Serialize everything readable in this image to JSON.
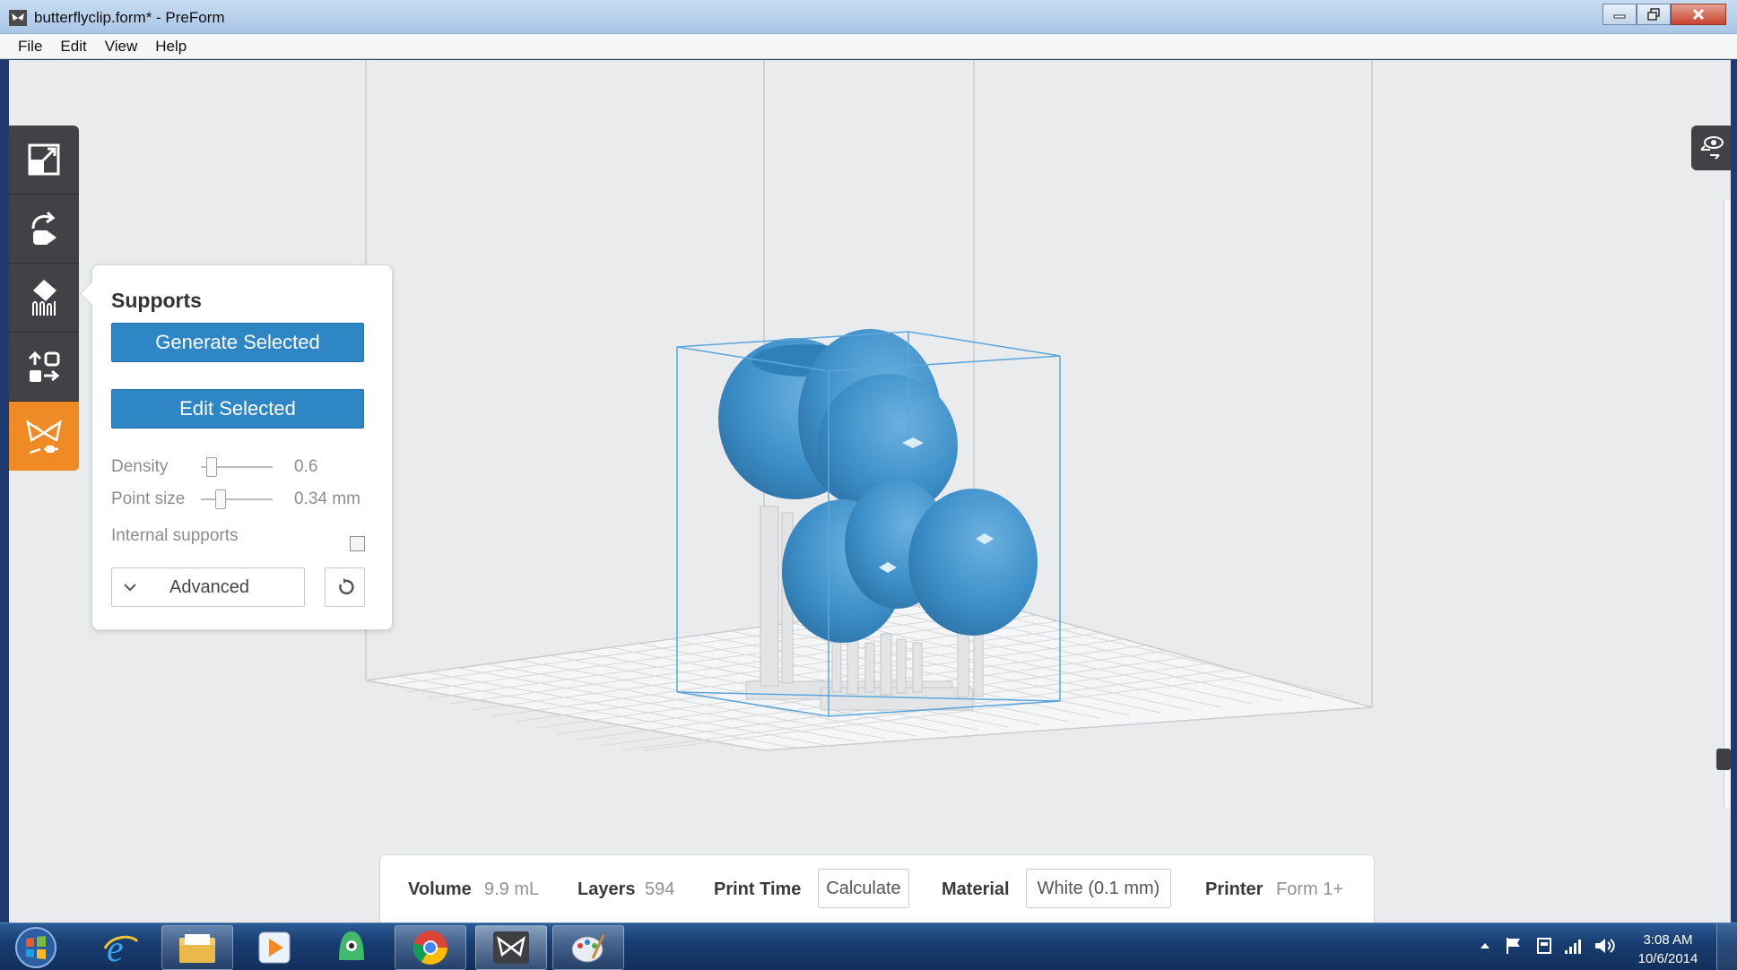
{
  "window": {
    "title": "butterflyclip.form* - PreForm"
  },
  "menu": [
    "File",
    "Edit",
    "View",
    "Help"
  ],
  "toolbar": {
    "tools": [
      "scale-tool",
      "orient-tool",
      "supports-tool",
      "layout-tool",
      "print-tool"
    ],
    "active_tool": "print-tool"
  },
  "supports_panel": {
    "title": "Supports",
    "generate_label": "Generate Selected",
    "edit_label": "Edit Selected",
    "density_label": "Density",
    "density_value": "0.6",
    "point_size_label": "Point size",
    "point_size_value": "0.34 mm",
    "internal_supports_label": "Internal supports",
    "internal_supports_checked": false,
    "advanced_label": "Advanced"
  },
  "info_bar": {
    "volume_label": "Volume",
    "volume_value": "9.9 mL",
    "layers_label": "Layers",
    "layers_value": "594",
    "print_time_label": "Print Time",
    "calculate_label": "Calculate",
    "material_label": "Material",
    "material_value": "White (0.1 mm)",
    "printer_label": "Printer",
    "printer_value": "Form 1+"
  },
  "taskbar": {
    "time": "3:08 AM",
    "date": "10/6/2014"
  },
  "colors": {
    "accent": "#2f86c4",
    "model": "#3d8fc9",
    "active_tool": "#f08a24",
    "toolbar": "#404245"
  }
}
